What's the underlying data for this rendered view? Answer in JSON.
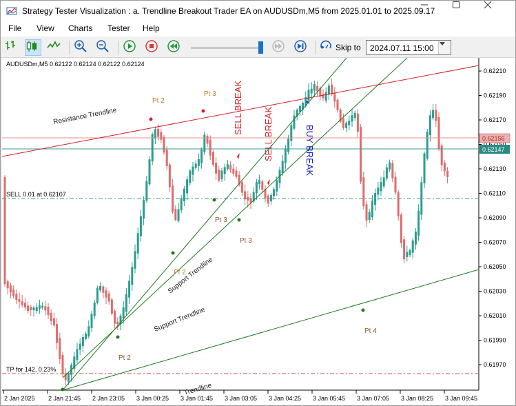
{
  "window": {
    "title": "Strategy Tester Visualization : a. Trendline Breakout Trader EA on AUDUSDm,M5 from 2025.01.01 to 2025.09.17",
    "minimize_icon": "minimize-icon",
    "maximize_icon": "maximize-icon",
    "close_icon": "close-icon"
  },
  "menu": [
    "File",
    "View",
    "Charts",
    "Tester",
    "Help"
  ],
  "toolbar": {
    "skip_label": "Skip to",
    "skip_date": "2024.07.11 15:00",
    "icons": [
      "bar-chart-icon",
      "candlestick-icon",
      "line-chart-icon",
      "zoom-in-icon",
      "zoom-out-icon",
      "play-icon",
      "stop-icon",
      "rewind-icon",
      "speed-slider",
      "step-forward-icon",
      "skip-to-end-icon",
      "skip-to-icon"
    ]
  },
  "chart": {
    "symbol_header": "AUDUSDm,M5  0.62122 0.62124 0.62122 0.62124",
    "price_ticks": [
      "0.62210",
      "0.62190",
      "0.62170",
      "0.62150",
      "0.62130",
      "0.62110",
      "0.62090",
      "0.62070",
      "0.62050",
      "0.62030",
      "0.62010",
      "0.61990",
      "0.61970"
    ],
    "time_ticks": [
      "2 Jan 2025",
      "2 Jan 21:45",
      "2 Jan 23:05",
      "3 Jan 00:25",
      "3 Jan 01:45",
      "3 Jan 03:05",
      "3 Jan 04:25",
      "3 Jan 05:45",
      "3 Jan 07:05",
      "3 Jan 08:25",
      "3 Jan 09:45"
    ],
    "price_tags": [
      {
        "value": "0.62156",
        "color": "#d04848"
      },
      {
        "value": "0.62147",
        "color": "#2a8a84"
      }
    ],
    "labels": {
      "resistance": "Resistance Trendline",
      "support_1": "Support Trendline",
      "support_2": "Support Trendline",
      "support_3": "Trendline",
      "sell_order": "SELL 0.01 at 0.62107",
      "tp_order": "TP for 142, 0.23%",
      "sell_break_1": "SELL BREAK",
      "sell_break_2": "SELL BREAK",
      "buy_break": "BUY BREAK",
      "pt2_res": "Pt 2",
      "pt3_res": "Pt 3",
      "pt3_a": "Pt 3",
      "pt3_b": "Pt 3",
      "pt2_sup": "Pt 2",
      "pt1_sup": "Pt 2",
      "pt4": "Pt 4"
    },
    "colors": {
      "bull": "#2a9d8f",
      "bear": "#e06b6b",
      "resistance": "#d0202a",
      "support": "#1f7a1f",
      "sell_break": "#d0202a",
      "buy_break": "#1a1ac8",
      "point_label": "#b8802a"
    }
  }
}
